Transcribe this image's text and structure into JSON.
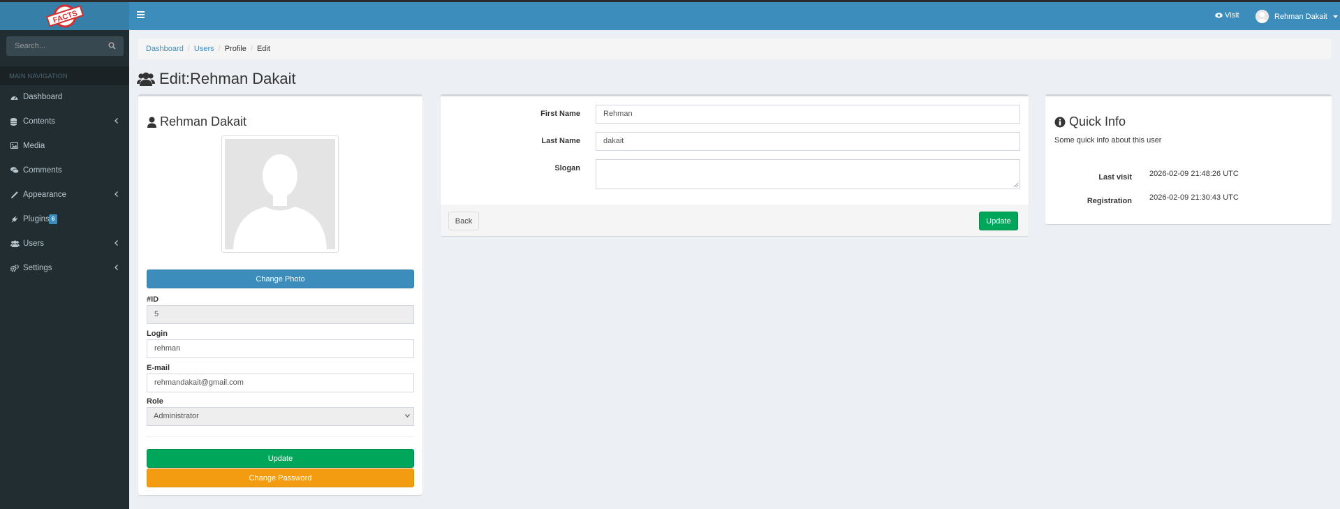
{
  "app": {
    "logo_text": "FACTS"
  },
  "header": {
    "visit_label": "Visit",
    "user_name": "Rehman Dakait"
  },
  "sidebar": {
    "search_placeholder": "Search...",
    "section_title": "MAIN NAVIGATION",
    "items": [
      {
        "label": "Dashboard",
        "icon": "dashboard-icon",
        "has_submenu": false
      },
      {
        "label": "Contents",
        "icon": "database-icon",
        "has_submenu": true
      },
      {
        "label": "Media",
        "icon": "image-icon",
        "has_submenu": false
      },
      {
        "label": "Comments",
        "icon": "comments-icon",
        "has_submenu": false
      },
      {
        "label": "Appearance",
        "icon": "paint-brush-icon",
        "has_submenu": true
      },
      {
        "label": "Plugins",
        "icon": "plug-icon",
        "has_submenu": false,
        "badge": "6"
      },
      {
        "label": "Users",
        "icon": "users-icon",
        "has_submenu": true
      },
      {
        "label": "Settings",
        "icon": "cogs-icon",
        "has_submenu": true
      }
    ]
  },
  "breadcrumb": {
    "items": [
      "Dashboard",
      "Users",
      "Profile",
      "Edit"
    ]
  },
  "page": {
    "title": "Edit:Rehman Dakait"
  },
  "profile_box": {
    "title": "Rehman Dakait",
    "change_photo_label": "Change Photo",
    "id_label": "#ID",
    "id_value": "5",
    "login_label": "Login",
    "login_value": "rehman",
    "email_label": "E-mail",
    "email_value": "rehmandakait@gmail.com",
    "role_label": "Role",
    "role_value": "Administrator",
    "update_label": "Update",
    "change_password_label": "Change Password"
  },
  "details_form": {
    "first_name_label": "First Name",
    "first_name_value": "Rehman",
    "last_name_label": "Last Name",
    "last_name_value": "dakait",
    "slogan_label": "Slogan",
    "slogan_value": "",
    "back_label": "Back",
    "update_label": "Update"
  },
  "quick_info": {
    "title": "Quick Info",
    "subtitle": "Some quick info about this user",
    "last_visit_label": "Last visit",
    "last_visit_value": "2026-02-09 21:48:26 UTC",
    "registration_label": "Registration",
    "registration_value": "2026-02-09 21:30:43 UTC"
  },
  "colors": {
    "header": "#3c8dbc",
    "sidebar": "#222d32",
    "primary": "#3c8dbc",
    "success": "#00a65a",
    "warning": "#f39c12",
    "badge": "#3c8dbc"
  }
}
